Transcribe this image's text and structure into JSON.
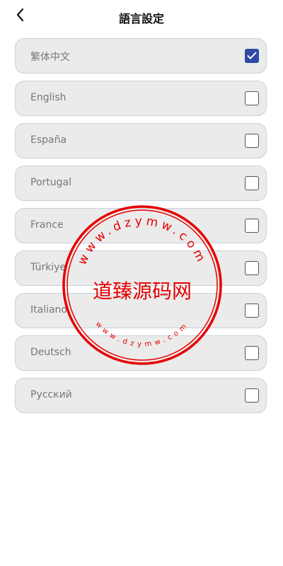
{
  "header": {
    "title": "語言設定",
    "back_icon": "chevron-left-icon"
  },
  "languages": [
    {
      "label": "繁体中文",
      "checked": true
    },
    {
      "label": "English",
      "checked": false
    },
    {
      "label": "España",
      "checked": false
    },
    {
      "label": "Portugal",
      "checked": false
    },
    {
      "label": "France",
      "checked": false
    },
    {
      "label": "Türkiye",
      "checked": false
    },
    {
      "label": "Italiano",
      "checked": false
    },
    {
      "label": "Deutsch",
      "checked": false
    },
    {
      "label": "Русский",
      "checked": false
    }
  ],
  "watermark": {
    "center_text": "道臻源码网",
    "top_arc": "www.dzymw.com",
    "bottom_arc": "www.dzymw.com",
    "color": "#e60000"
  },
  "colors": {
    "checked": "#2e4aa3",
    "item_bg": "#ebebeb",
    "item_border": "#c9d0dc"
  }
}
